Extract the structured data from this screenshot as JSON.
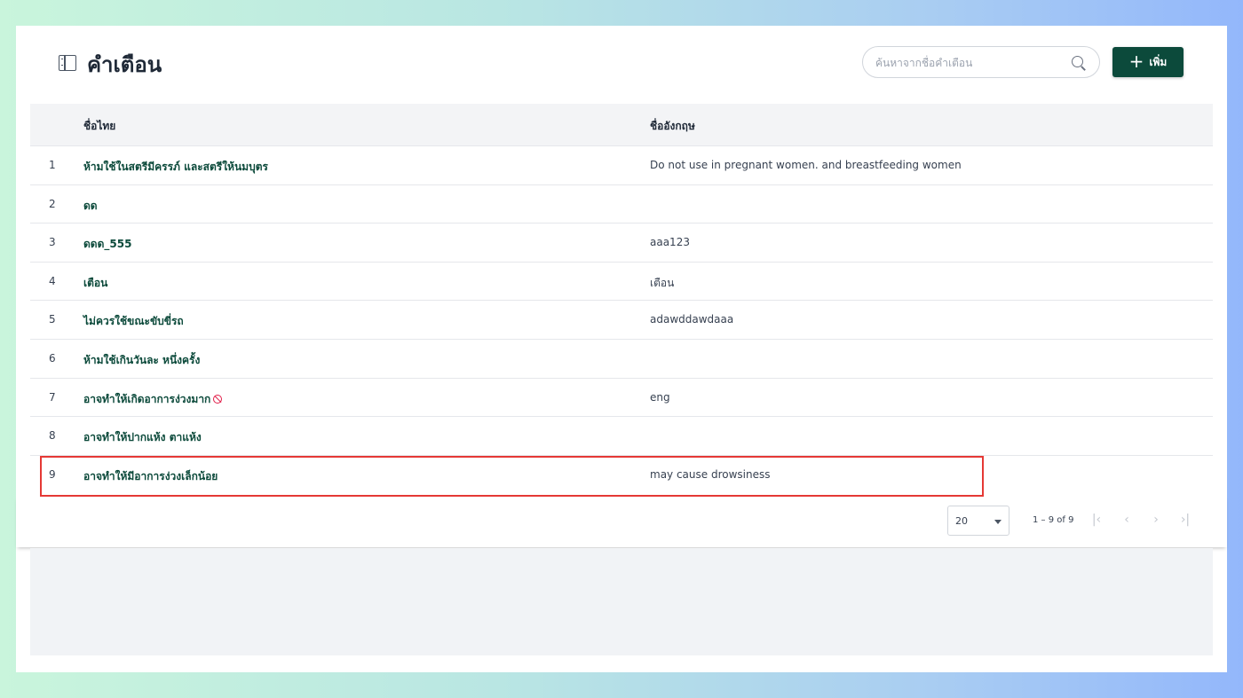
{
  "header": {
    "title": "คำเตือน",
    "search_placeholder": "ค้นหาจากชื่อคำเตือน",
    "add_label": "เพิ่ม"
  },
  "table": {
    "columns": [
      "ชื่อไทย",
      "ชื่ออังกฤษ"
    ],
    "rows": [
      {
        "no": "1",
        "th": "ห้ามใช้ในสตรีมีครรภ์ และสตรีให้นมบุตร",
        "en": "Do not use in pregnant women. and breastfeeding women"
      },
      {
        "no": "2",
        "th": "ดด",
        "en": ""
      },
      {
        "no": "3",
        "th": "ดดด_555",
        "en": "aaa123"
      },
      {
        "no": "4",
        "th": "เตือน",
        "en": "เตือน"
      },
      {
        "no": "5",
        "th": "ไม่ควรใช้ขณะขับขี่รถ",
        "en": "adawddawdaaa"
      },
      {
        "no": "6",
        "th": "ห้ามใช้เกินวันละ หนึ่งครั้ง",
        "en": ""
      },
      {
        "no": "7",
        "th": "อาจทำให้เกิดอาการง่วงมาก",
        "en": "eng"
      },
      {
        "no": "8",
        "th": "อาจทำให้ปากแห้ง ตาแห้ง",
        "en": ""
      },
      {
        "no": "9",
        "th": "อาจทำให้มีอาการง่วงเล็กน้อย",
        "en": "may cause drowsiness"
      }
    ]
  },
  "paginator": {
    "page_size": "20",
    "range_label": "1 – 9 of 9"
  },
  "icons": {
    "title": "sidebar-panel-icon",
    "search": "search-icon",
    "add": "plus-icon",
    "row7_badge": "ban-icon"
  },
  "colors": {
    "primary": "#0c4a3b",
    "highlight_border": "#e53935",
    "ban": "#e11d48"
  }
}
